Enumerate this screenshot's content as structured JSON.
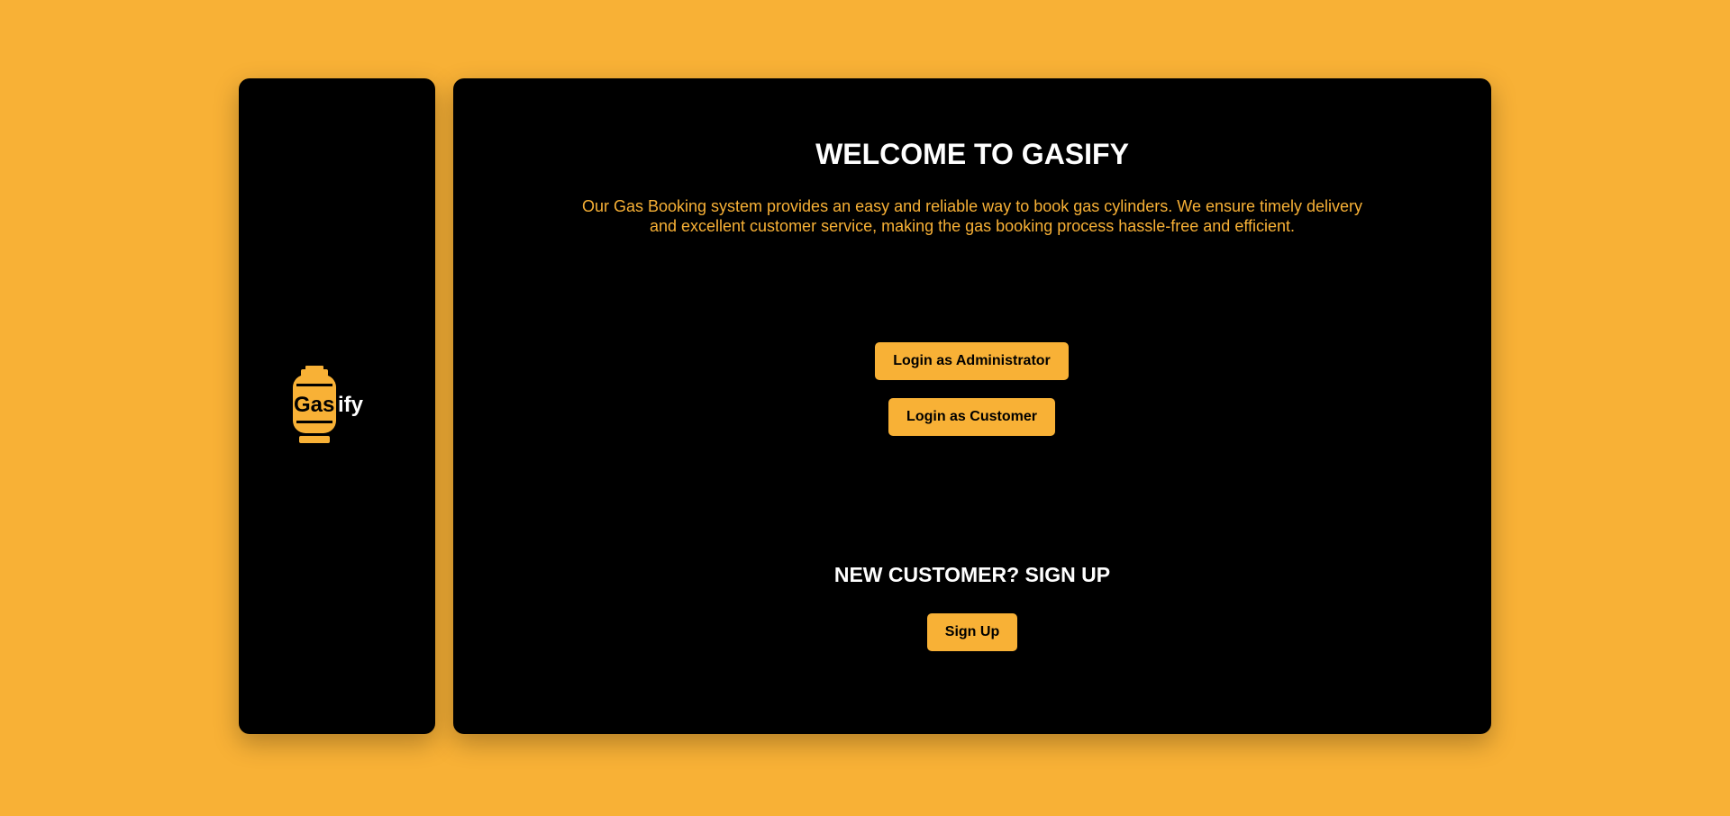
{
  "brand": {
    "part1": "Gas",
    "part2": "ify",
    "icon": "gas-cylinder-icon",
    "accent_color": "#f8b136"
  },
  "main": {
    "title": "WELCOME TO GASIFY",
    "description": "Our Gas Booking system provides an easy and reliable way to book gas cylinders. We ensure timely delivery and excellent customer service, making the gas booking process hassle-free and efficient.",
    "admin_login_label": "Login as Administrator",
    "customer_login_label": "Login as Customer",
    "signup_heading": "NEW CUSTOMER? SIGN UP",
    "signup_label": "Sign Up"
  }
}
